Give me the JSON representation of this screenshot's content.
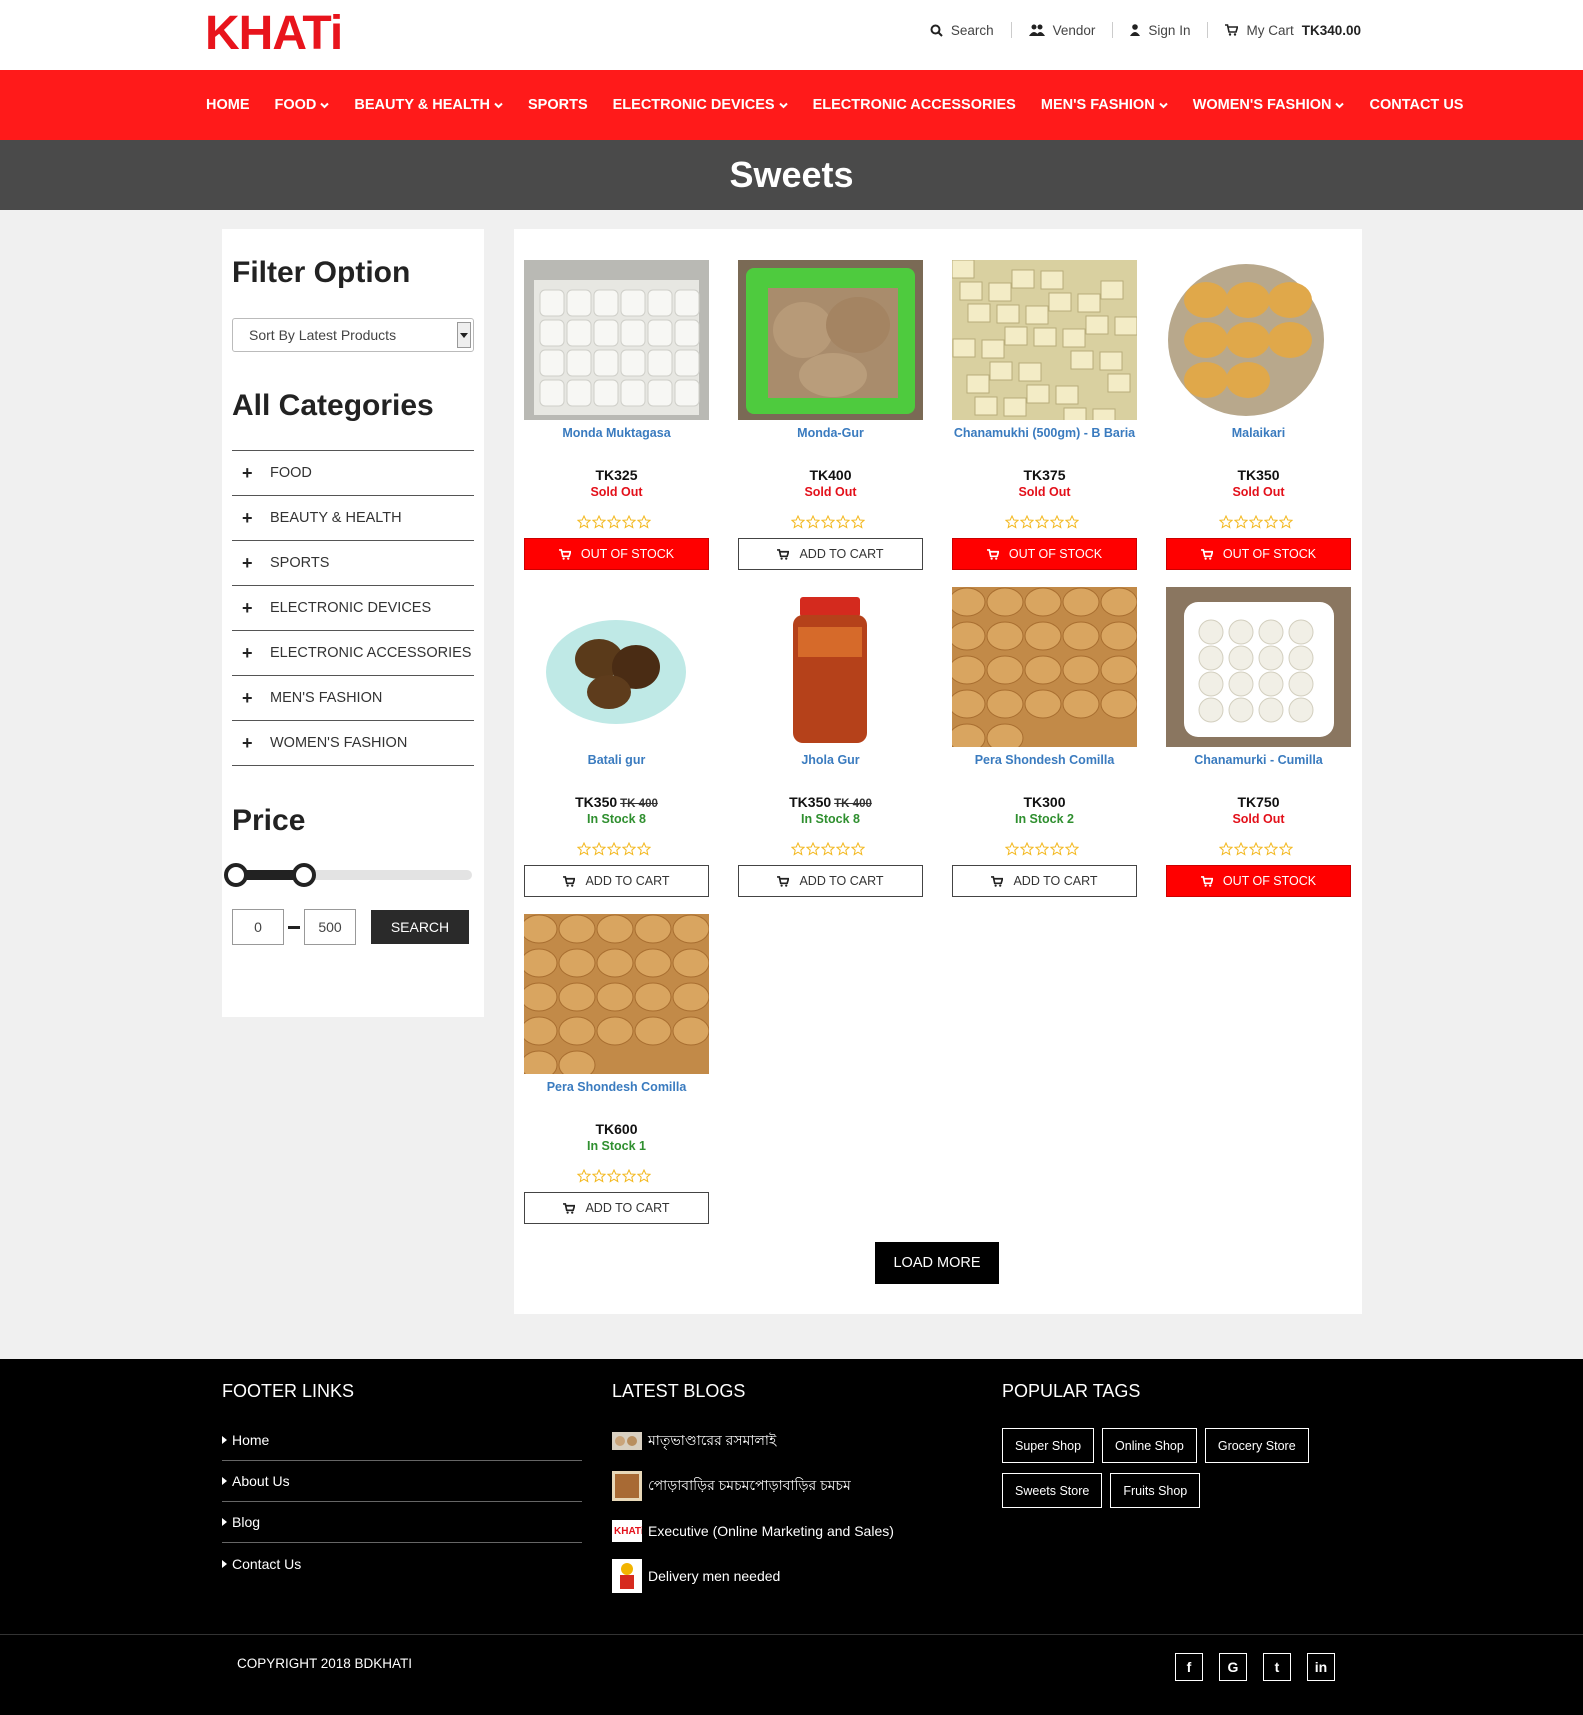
{
  "brand": {
    "logo_text": "KHATi",
    "accent": "#ff1a1a"
  },
  "top_links": {
    "search": "Search",
    "vendor": "Vendor",
    "sign_in": "Sign In",
    "cart_label": "My Cart",
    "cart_total": "TK340.00"
  },
  "nav": [
    {
      "label": "HOME",
      "dropdown": false
    },
    {
      "label": "FOOD",
      "dropdown": true
    },
    {
      "label": "BEAUTY & HEALTH",
      "dropdown": true
    },
    {
      "label": "SPORTS",
      "dropdown": false
    },
    {
      "label": "ELECTRONIC DEVICES",
      "dropdown": true
    },
    {
      "label": "ELECTRONIC ACCESSORIES",
      "dropdown": false
    },
    {
      "label": "MEN'S FASHION",
      "dropdown": true
    },
    {
      "label": "WOMEN'S FASHION",
      "dropdown": true
    },
    {
      "label": "CONTACT US",
      "dropdown": false
    }
  ],
  "page_title": "Sweets",
  "sidebar": {
    "filter_heading": "Filter Option",
    "sort_value": "Sort By Latest Products",
    "categories_heading": "All Categories",
    "categories": [
      "FOOD",
      "BEAUTY & HEALTH",
      "SPORTS",
      "ELECTRONIC DEVICES",
      "ELECTRONIC ACCESSORIES",
      "MEN'S FASHION",
      "WOMEN'S FASHION"
    ],
    "price_heading": "Price",
    "price_min": "0",
    "price_max": "500",
    "search_label": "SEARCH"
  },
  "products": [
    {
      "name": "Monda Muktagasa",
      "price": "TK325",
      "old_price": "",
      "stock": "Sold Out",
      "in_stock": false,
      "button": "OUT OF STOCK",
      "img": "monda"
    },
    {
      "name": "Monda-Gur",
      "price": "TK400",
      "old_price": "",
      "stock": "Sold Out",
      "in_stock": false,
      "button": "ADD TO CART",
      "img": "gur-tray"
    },
    {
      "name": "Chanamukhi (500gm) - B Baria",
      "price": "TK375",
      "old_price": "",
      "stock": "Sold Out",
      "in_stock": false,
      "button": "OUT OF STOCK",
      "img": "chanamukhi"
    },
    {
      "name": "Malaikari",
      "price": "TK350",
      "old_price": "",
      "stock": "Sold Out",
      "in_stock": false,
      "button": "OUT OF STOCK",
      "img": "malaikari"
    },
    {
      "name": "Batali gur",
      "price": "TK350",
      "old_price": "TK 400",
      "stock": "In Stock 8",
      "in_stock": true,
      "button": "ADD TO CART",
      "img": "batali"
    },
    {
      "name": "Jhola Gur",
      "price": "TK350",
      "old_price": "TK 400",
      "stock": "In Stock 8",
      "in_stock": true,
      "button": "ADD TO CART",
      "img": "jhola"
    },
    {
      "name": "Pera Shondesh Comilla",
      "price": "TK300",
      "old_price": "",
      "stock": "In Stock 2",
      "in_stock": true,
      "button": "ADD TO CART",
      "img": "pera"
    },
    {
      "name": "Chanamurki - Cumilla",
      "price": "TK750",
      "old_price": "",
      "stock": "Sold Out",
      "in_stock": false,
      "button": "OUT OF STOCK",
      "img": "chanamurki"
    },
    {
      "name": "Pera Shondesh Comilla",
      "price": "TK600",
      "old_price": "",
      "stock": "In Stock 1",
      "in_stock": true,
      "button": "ADD TO CART",
      "img": "pera"
    }
  ],
  "load_more": "LOAD MORE",
  "footer": {
    "links_heading": "FOOTER LINKS",
    "links": [
      "Home",
      "About Us",
      "Blog",
      "Contact Us"
    ],
    "blogs_heading": "LATEST BLOGS",
    "blogs": [
      "মাতৃভাণ্ডারের রসমালাই",
      "পোড়াবাড়ির চমচমপোড়াবাড়ির চমচম",
      "Executive (Online Marketing and Sales)",
      "Delivery men needed"
    ],
    "tags_heading": "POPULAR TAGS",
    "tags": [
      "Super Shop",
      "Online Shop",
      "Grocery Store",
      "Sweets Store",
      "Fruits Shop"
    ],
    "copyright": "COPYRIGHT 2018 BDKHATI",
    "social": [
      {
        "icon": "facebook-icon",
        "glyph": "f"
      },
      {
        "icon": "google-icon",
        "glyph": "G"
      },
      {
        "icon": "twitter-icon",
        "glyph": "t"
      },
      {
        "icon": "linkedin-icon",
        "glyph": "in"
      }
    ]
  }
}
